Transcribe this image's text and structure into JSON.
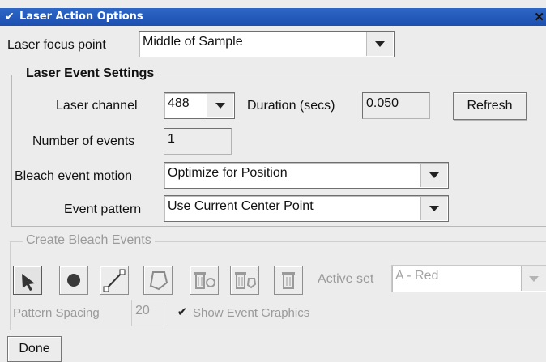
{
  "window": {
    "title": "Laser Action Options",
    "menu_icon": "chevron-down-icon",
    "close_icon": "close-icon"
  },
  "focus": {
    "label": "Laser focus point",
    "value": "Middle of Sample"
  },
  "laser_event_settings": {
    "title": "Laser Event Settings",
    "channel_label": "Laser channel",
    "channel_value": "488",
    "duration_label": "Duration (secs)",
    "duration_value": "0.050",
    "refresh_label": "Refresh",
    "events_label": "Number of events",
    "events_value": "1",
    "motion_label": "Bleach event motion",
    "motion_value": "Optimize for Position",
    "pattern_label": "Event pattern",
    "pattern_value": "Use Current Center Point"
  },
  "create_bleach_events": {
    "title": "Create Bleach Events",
    "tools": [
      "pointer-tool-icon",
      "point-tool-icon",
      "line-tool-icon",
      "polygon-tool-icon"
    ],
    "delete_tools": [
      "delete-point-icon",
      "delete-shape-icon",
      "delete-all-icon"
    ],
    "active_set_label": "Active set",
    "active_set_value": "A - Red",
    "spacing_label": "Pattern Spacing",
    "spacing_value": "20",
    "show_graphics_label": "Show Event Graphics",
    "show_graphics_checked": true,
    "checkmark": "✔"
  },
  "footer": {
    "done_label": "Done"
  },
  "colors": {
    "titlebar": "#1c4fb0",
    "panel": "#ececec",
    "disabled_text": "#9a9a9a"
  }
}
